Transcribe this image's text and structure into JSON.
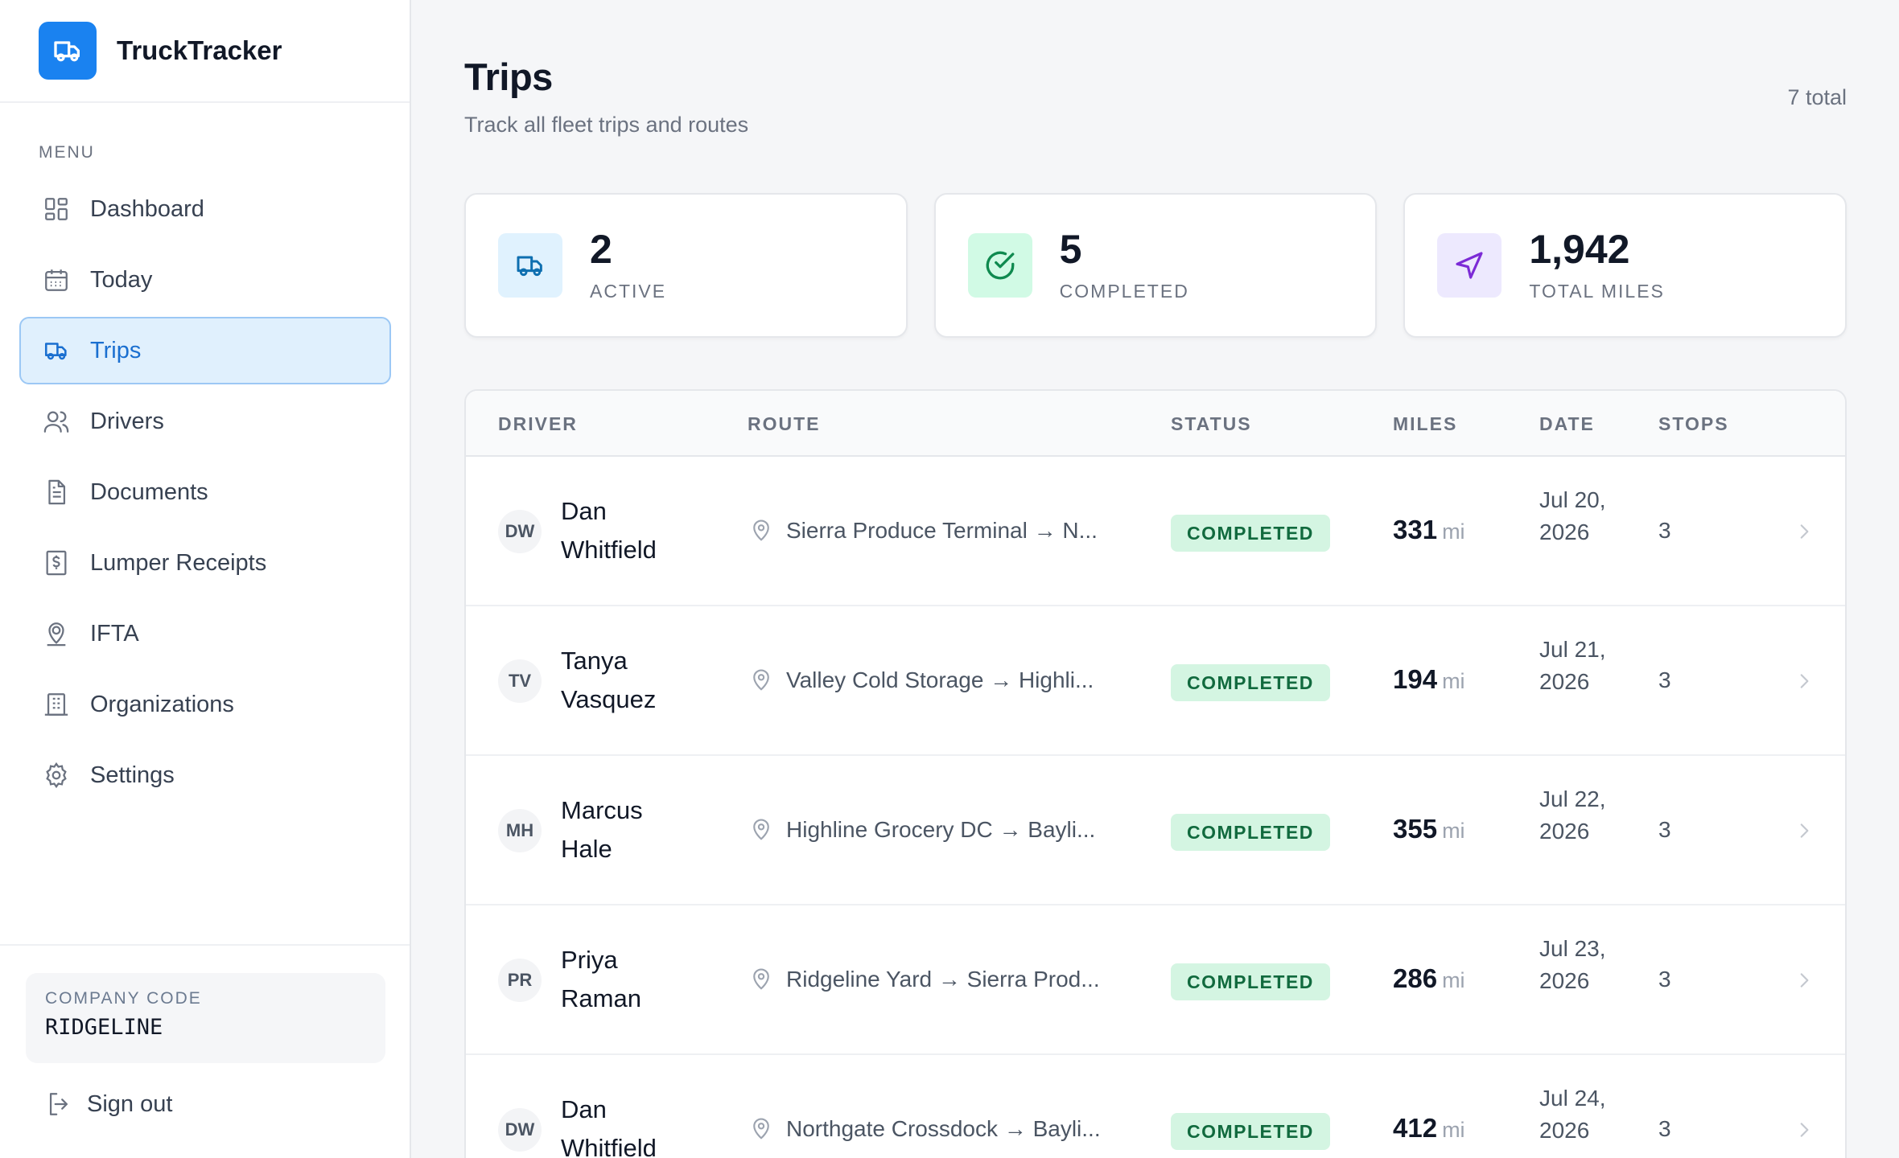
{
  "app": {
    "name": "TruckTracker",
    "brand_color": "#1a82f0"
  },
  "sidebar": {
    "menu_label": "MENU",
    "items": [
      {
        "label": "Dashboard",
        "icon": "grid-icon"
      },
      {
        "label": "Today",
        "icon": "calendar-icon"
      },
      {
        "label": "Trips",
        "icon": "truck-icon",
        "active": true
      },
      {
        "label": "Drivers",
        "icon": "users-icon"
      },
      {
        "label": "Documents",
        "icon": "document-icon"
      },
      {
        "label": "Lumper Receipts",
        "icon": "receipt-icon"
      },
      {
        "label": "IFTA",
        "icon": "map-pin-person-icon"
      },
      {
        "label": "Organizations",
        "icon": "building-icon"
      },
      {
        "label": "Settings",
        "icon": "gear-icon"
      }
    ],
    "company_label": "COMPANY CODE",
    "company_code": "RIDGELINE",
    "sign_out": "Sign out"
  },
  "header": {
    "title": "Trips",
    "subtitle": "Track all fleet trips and routes",
    "total": "7 total"
  },
  "stats": [
    {
      "value": "2",
      "label": "ACTIVE",
      "icon": "truck-icon",
      "color": "#0e6fb0",
      "bg": "#e0f2fe"
    },
    {
      "value": "5",
      "label": "COMPLETED",
      "icon": "check-circle-icon",
      "color": "#0f8a4f",
      "bg": "#d1fae5"
    },
    {
      "value": "1,942",
      "label": "TOTAL MILES",
      "icon": "navigation-icon",
      "color": "#7c2bd6",
      "bg": "#ede9fe"
    }
  ],
  "table": {
    "columns": [
      "DRIVER",
      "ROUTE",
      "STATUS",
      "MILES",
      "DATE",
      "STOPS"
    ],
    "miles_unit": "mi",
    "rows": [
      {
        "initials": "DW",
        "driver": "Dan Whitfield",
        "route": "Sierra Produce Terminal → N...",
        "status": "COMPLETED",
        "miles": "331",
        "date": "Jul 20, 2026",
        "stops": "3"
      },
      {
        "initials": "TV",
        "driver": "Tanya Vasquez",
        "route": "Valley Cold Storage → Highli...",
        "status": "COMPLETED",
        "miles": "194",
        "date": "Jul 21, 2026",
        "stops": "3"
      },
      {
        "initials": "MH",
        "driver": "Marcus Hale",
        "route": "Highline Grocery DC → Bayli...",
        "status": "COMPLETED",
        "miles": "355",
        "date": "Jul 22, 2026",
        "stops": "3"
      },
      {
        "initials": "PR",
        "driver": "Priya Raman",
        "route": "Ridgeline Yard → Sierra Prod...",
        "status": "COMPLETED",
        "miles": "286",
        "date": "Jul 23, 2026",
        "stops": "3"
      },
      {
        "initials": "DW",
        "driver": "Dan Whitfield",
        "route": "Northgate Crossdock → Bayli...",
        "status": "COMPLETED",
        "miles": "412",
        "date": "Jul 24, 2026",
        "stops": "3"
      }
    ]
  }
}
